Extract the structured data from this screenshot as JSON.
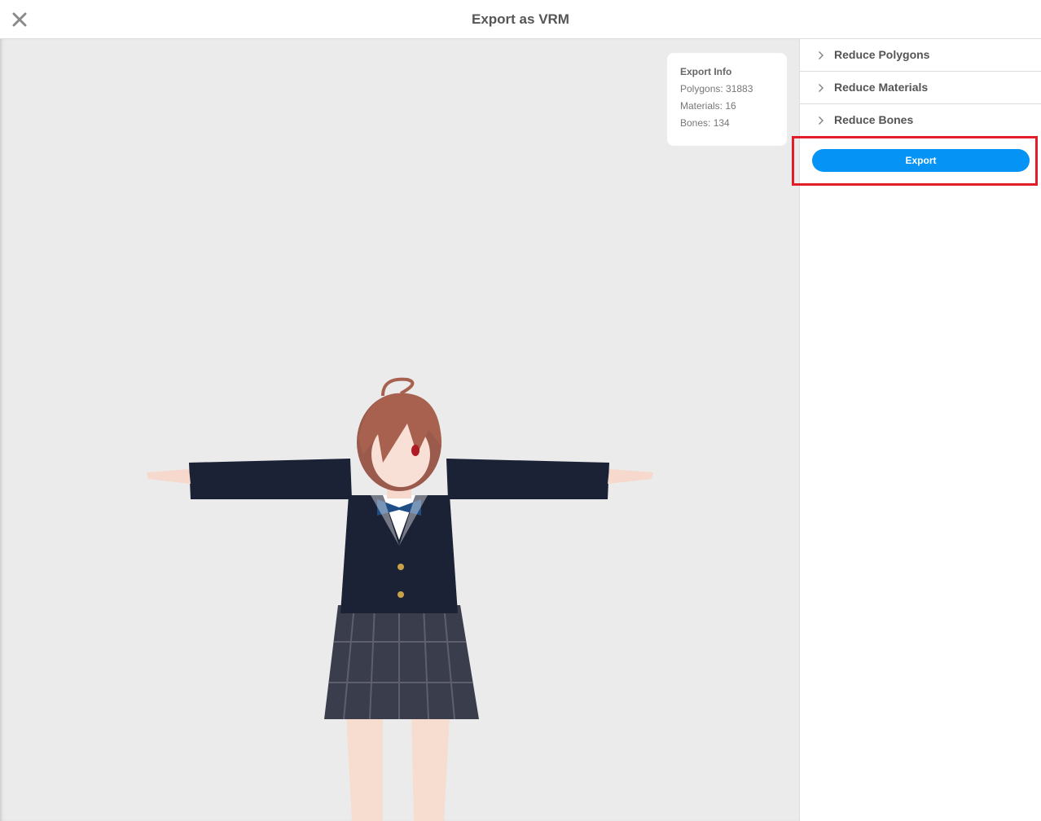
{
  "header": {
    "title": "Export as VRM"
  },
  "info": {
    "title": "Export Info",
    "polygons": "Polygons: 31883",
    "materials": "Materials: 16",
    "bones": "Bones: 134"
  },
  "sidebar": {
    "items": [
      {
        "label": "Reduce Polygons"
      },
      {
        "label": "Reduce Materials"
      },
      {
        "label": "Reduce Bones"
      }
    ],
    "export_label": "Export"
  },
  "colors": {
    "accent": "#0593f5",
    "highlight": "#e11d2a",
    "viewport_bg": "#ebebeb"
  }
}
